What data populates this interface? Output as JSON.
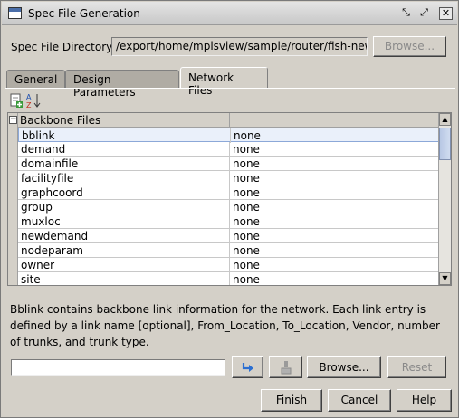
{
  "window": {
    "title": "Spec File Generation"
  },
  "spec_dir": {
    "label": "Spec File Directory:",
    "value": "/export/home/mplsview/sample/router/fish-new",
    "browse_label": "Browse..."
  },
  "tabs": [
    {
      "label": "General"
    },
    {
      "label": "Design Parameters"
    },
    {
      "label": "Network Files"
    }
  ],
  "table": {
    "group_label": "Backbone Files",
    "rows": [
      {
        "name": "bblink",
        "value": "none"
      },
      {
        "name": "demand",
        "value": "none"
      },
      {
        "name": "domainfile",
        "value": "none"
      },
      {
        "name": "facilityfile",
        "value": "none"
      },
      {
        "name": "graphcoord",
        "value": "none"
      },
      {
        "name": "group",
        "value": "none"
      },
      {
        "name": "muxloc",
        "value": "none"
      },
      {
        "name": "newdemand",
        "value": "none"
      },
      {
        "name": "nodeparam",
        "value": "none"
      },
      {
        "name": "owner",
        "value": "none"
      },
      {
        "name": "site",
        "value": "none"
      }
    ]
  },
  "description": "Bblink contains backbone link information for the network. Each link entry is defined by a link name [optional], From_Location, To_Location, Vendor, number of trunks, and trunk type.",
  "file_input": {
    "value": ""
  },
  "bottom_buttons": {
    "browse": "Browse...",
    "reset": "Reset"
  },
  "dialog_buttons": {
    "finish": "Finish",
    "cancel": "Cancel",
    "help": "Help"
  },
  "colors": {
    "selected_row": "#eaf0fa",
    "panel": "#d4d0c8",
    "accent": "#2c6fd1"
  }
}
